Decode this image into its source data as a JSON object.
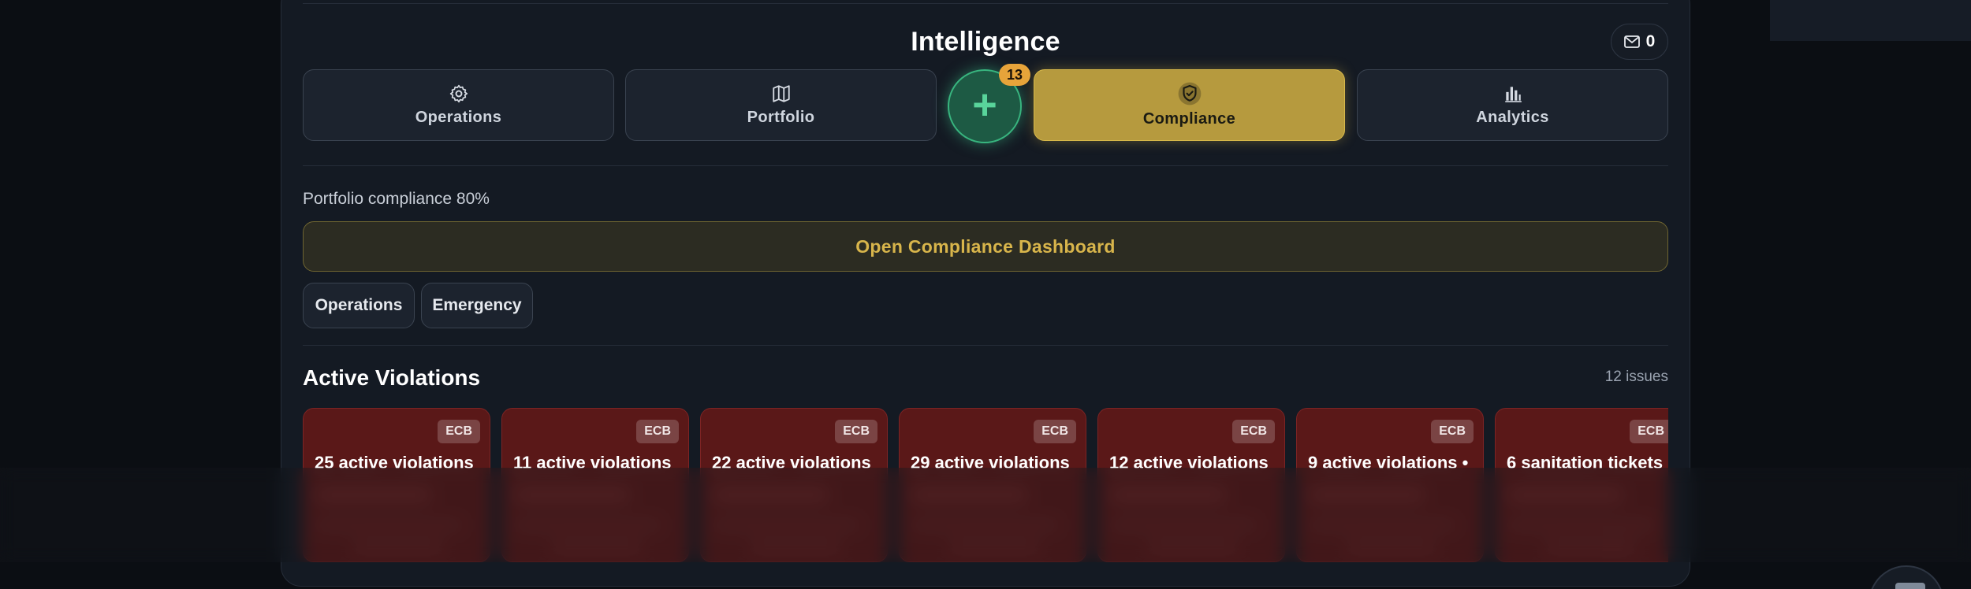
{
  "header": {
    "title": "Intelligence",
    "messages_count": "0"
  },
  "tabs": [
    {
      "label": "Operations",
      "icon": "gear-icon",
      "active": false
    },
    {
      "label": "Portfolio",
      "icon": "map-icon",
      "active": false
    },
    {
      "label": "Compliance",
      "icon": "shield-check-icon",
      "active": true
    },
    {
      "label": "Analytics",
      "icon": "bar-chart-icon",
      "active": false
    }
  ],
  "add_button": {
    "icon": "plus-icon",
    "badge": "13"
  },
  "compliance": {
    "summary": "Portfolio compliance 80%",
    "dashboard_button": "Open Compliance Dashboard"
  },
  "filters": [
    "Operations",
    "Emergency"
  ],
  "violations": {
    "title": "Active Violations",
    "count_label": "12 issues",
    "cards": [
      {
        "tag": "ECB",
        "title": "25 active violations"
      },
      {
        "tag": "ECB",
        "title": "11 active violations"
      },
      {
        "tag": "ECB",
        "title": "22 active violations"
      },
      {
        "tag": "ECB",
        "title": "29 active violations"
      },
      {
        "tag": "ECB",
        "title": "12 active violations"
      },
      {
        "tag": "ECB",
        "title": "9 active violations •"
      },
      {
        "tag": "ECB",
        "title": "6 sanitation tickets"
      }
    ]
  },
  "colors": {
    "accent_gold": "#b69a3e",
    "add_green": "#38b57f",
    "badge_orange": "#e7a43a",
    "card_red": "#5a1818"
  }
}
